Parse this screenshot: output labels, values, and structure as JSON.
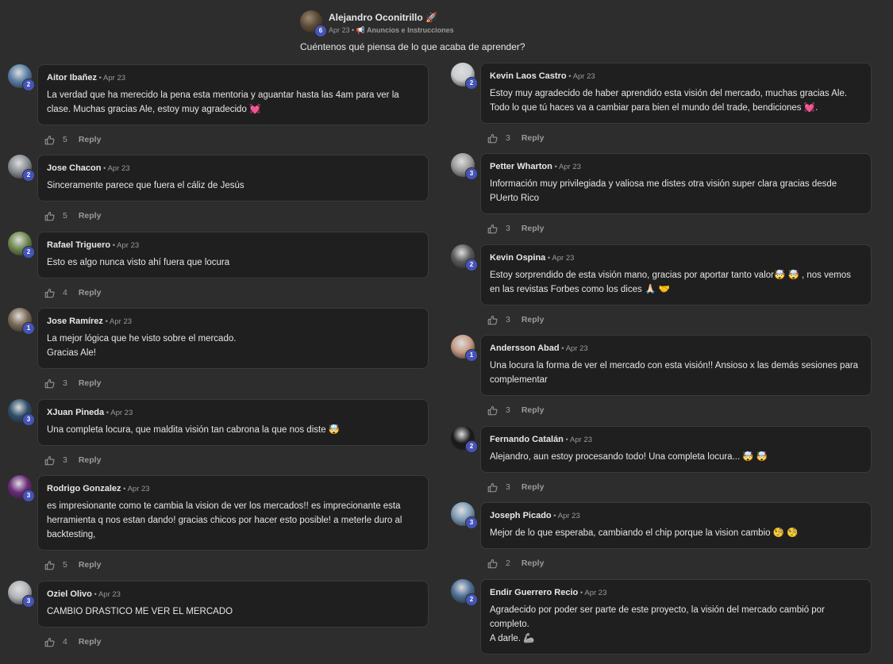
{
  "post": {
    "author": "Alejandro Oconitrillo",
    "author_emoji": "🚀",
    "author_level": "6",
    "date": "Apr 23",
    "category": "📢 Anuncios e Instrucciones",
    "question": "Cuéntenos qué piensa de lo que acaba de aprender?"
  },
  "reply_label": "Reply",
  "left_comments": [
    {
      "name": "Aitor Ibañez",
      "date": "Apr 23",
      "level": "2",
      "likes": "5",
      "text": "La verdad que ha merecido la pena esta mentoria y aguantar hasta las 4am para ver la clase. Muchas gracias Ale, estoy muy agradecido 💓",
      "avatar_color": "#5b7fa6"
    },
    {
      "name": "Jose Chacon",
      "date": "Apr 23",
      "level": "2",
      "likes": "5",
      "text": "Sinceramente parece que fuera el cáliz de Jesús",
      "avatar_color": "#8a8f94"
    },
    {
      "name": "Rafael Triguero",
      "date": "Apr 23",
      "level": "2",
      "likes": "4",
      "text": "Esto es algo nunca visto ahí fuera que locura",
      "avatar_color": "#6f8a4e"
    },
    {
      "name": "Jose Ramírez",
      "date": "Apr 23",
      "level": "1",
      "likes": "3",
      "text": "La mejor lógica que he visto sobre el mercado.\nGracias Ale!",
      "avatar_color": "#7a6a55"
    },
    {
      "name": "XJuan Pineda",
      "date": "Apr 23",
      "level": "3",
      "likes": "3",
      "text": "Una completa locura, que maldita visión tan cabrona la que nos diste 🤯",
      "avatar_color": "#2f4f6a"
    },
    {
      "name": "Rodrigo Gonzalez",
      "date": "Apr 23",
      "level": "3",
      "likes": "5",
      "text": "es impresionante como te cambia la vision de ver los mercados!! es imprecionante esta herramienta q nos estan dando! gracias chicos por hacer esto posible! a meterle duro al backtesting,",
      "avatar_color": "#6a2a7a"
    },
    {
      "name": "Oziel Olivo",
      "date": "Apr 23",
      "level": "3",
      "likes": "4",
      "text": "CAMBIO DRASTICO ME VER EL MERCADO",
      "avatar_color": "#b0b4b8"
    }
  ],
  "right_comments": [
    {
      "name": "Kevin Laos Castro",
      "date": "Apr 23",
      "level": "2",
      "likes": "3",
      "text": "Estoy muy agradecido de haber aprendido esta visión del mercado, muchas gracias Ale. Todo lo que tú haces va a cambiar para bien el mundo del trade, bendiciones 💓.",
      "avatar_color": "#c9ccd0"
    },
    {
      "name": "Petter Wharton",
      "date": "Apr 23",
      "level": "3",
      "likes": "3",
      "text": "Información muy privilegiada y valiosa me distes otra visión super clara gracias desde PUerto Rico",
      "avatar_color": "#9a9a9a"
    },
    {
      "name": "Kevin Ospina",
      "date": "Apr 23",
      "level": "2",
      "likes": "3",
      "text": "Estoy sorprendido de esta visión mano, gracias por aportar tanto valor🤯 🤯 , nos vemos en las revistas Forbes como los dices 🙏🏻 🤝",
      "avatar_color": "#5a5a5a"
    },
    {
      "name": "Andersson Abad",
      "date": "Apr 23",
      "level": "1",
      "likes": "3",
      "text": "Una locura la forma de ver el mercado con esta visión!! Ansioso x las demás sesiones para complementar",
      "avatar_color": "#c79a84"
    },
    {
      "name": "Fernando Catalán",
      "date": "Apr 23",
      "level": "2",
      "likes": "3",
      "text": "Alejandro, aun estoy procesando todo! Una completa locura... 🤯 🤯",
      "avatar_color": "#1a1a1a"
    },
    {
      "name": "Joseph Picado",
      "date": "Apr 23",
      "level": "3",
      "likes": "2",
      "text": "Mejor de lo que esperaba, cambiando el chip porque la vision cambio 🧐 🧐",
      "avatar_color": "#7d9bb5"
    },
    {
      "name": "Endir Guerrero Recio",
      "date": "Apr 23",
      "level": "2",
      "likes": "",
      "text": "Agradecido por poder ser parte de este proyecto, la visión del mercado cambió por completo.\nA darle. 🦾",
      "avatar_color": "#4e6f95"
    }
  ]
}
